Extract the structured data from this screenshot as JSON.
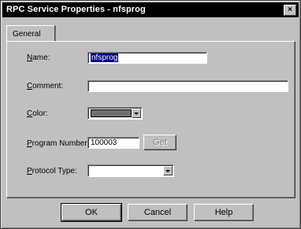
{
  "window": {
    "title": "RPC Service Properties - nfsprog"
  },
  "tabs": [
    {
      "label": "General"
    }
  ],
  "form": {
    "name_label": "Name:",
    "name_value": "nfsprog",
    "comment_label": "Comment:",
    "comment_value": "",
    "color_label": "Color:",
    "color_value": "#6f6f6f",
    "program_number_label": "Program Number:",
    "program_number_value": "100003",
    "get_button": "Get",
    "protocol_type_label": "Protocol Type:",
    "protocol_type_value": ""
  },
  "buttons": {
    "ok": "OK",
    "cancel": "Cancel",
    "help": "Help"
  }
}
